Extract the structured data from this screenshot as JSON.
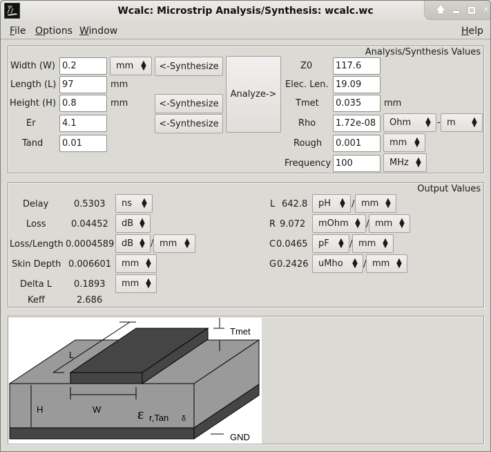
{
  "window": {
    "title": "Wcalc: Microstrip Analysis/Synthesis: wcalc.wc",
    "controls": [
      "shade",
      "minimize",
      "maximize",
      "close"
    ]
  },
  "menubar": {
    "file": "File",
    "options": "Options",
    "window": "Window",
    "help": "Help"
  },
  "analysis": {
    "frame_label": "Analysis/Synthesis Values",
    "width": {
      "label": "Width (W)",
      "value": "0.2",
      "unit": "mm"
    },
    "length": {
      "label": "Length (L)",
      "value": "97",
      "unit": "mm"
    },
    "height": {
      "label": "Height (H)",
      "value": "0.8",
      "unit": "mm"
    },
    "er": {
      "label": "Er",
      "value": "4.1"
    },
    "tand": {
      "label": "Tand",
      "value": "0.01"
    },
    "synthesize_label": "<-Synthesize",
    "analyze_label": "Analyze->",
    "z0": {
      "label": "Z0",
      "value": "117.6"
    },
    "elec_len": {
      "label": "Elec. Len.",
      "value": "19.09"
    },
    "tmet": {
      "label": "Tmet",
      "value": "0.035",
      "unit": "mm"
    },
    "rho": {
      "label": "Rho",
      "value": "1.72e-08",
      "unit1": "Ohm",
      "sep": "-",
      "unit2": "m"
    },
    "rough": {
      "label": "Rough",
      "value": "0.001",
      "unit": "mm"
    },
    "frequency": {
      "label": "Frequency",
      "value": "100",
      "unit": "MHz"
    }
  },
  "output": {
    "frame_label": "Output Values",
    "delay": {
      "label": "Delay",
      "value": "0.5303",
      "unit": "ns"
    },
    "loss": {
      "label": "Loss",
      "value": "0.04452",
      "unit": "dB"
    },
    "loss_length": {
      "label": "Loss/Length",
      "value": "0.0004589",
      "unit1": "dB",
      "sep": "/",
      "unit2": "mm"
    },
    "skin_depth": {
      "label": "Skin Depth",
      "value": "0.006601",
      "unit": "mm"
    },
    "delta_l": {
      "label": "Delta L",
      "value": "0.1893",
      "unit": "mm"
    },
    "keff": {
      "label": "Keff",
      "value": "2.686"
    },
    "L": {
      "label": "L",
      "value": "642.8",
      "unit1": "pH",
      "sep": "/",
      "unit2": "mm"
    },
    "R": {
      "label": "R",
      "value": "9.072",
      "unit1": "mOhm",
      "sep": "/",
      "unit2": "mm"
    },
    "C": {
      "label": "C",
      "value": "0.0465",
      "unit1": "pF",
      "sep": "/",
      "unit2": "mm"
    },
    "G": {
      "label": "G",
      "value": "0.2426",
      "unit1": "uMho",
      "sep": "/",
      "unit2": "mm"
    }
  },
  "diagram": {
    "labels": {
      "L": "L",
      "W": "W",
      "H": "H",
      "tmet": "Tmet",
      "gnd": "GND",
      "eps": "ε",
      "eps_sub": "r,Tan",
      "delta": "δ"
    },
    "colors": {
      "substrate": "#9a9a9a",
      "metal": "#454545",
      "bg": "#ffffff"
    }
  }
}
